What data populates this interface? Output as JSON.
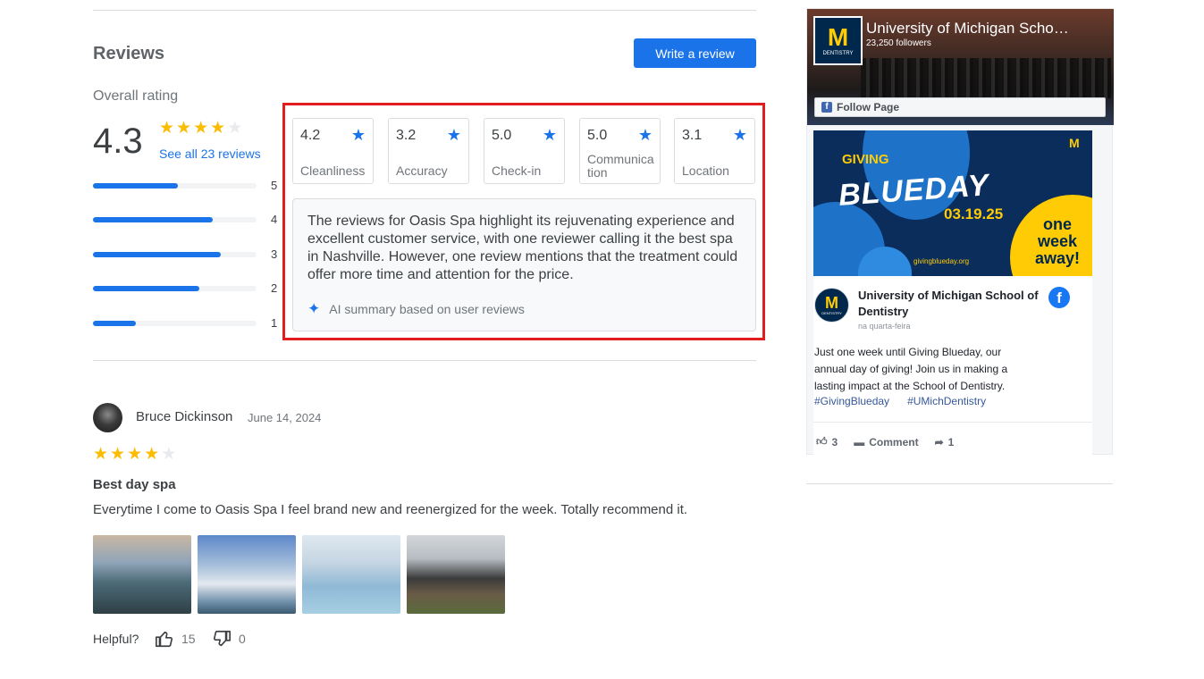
{
  "reviews": {
    "title": "Reviews",
    "write_label": "Write a review",
    "overall_label": "Overall rating",
    "rating": "4.3",
    "rating_stars": 4,
    "see_all": "See all 23 reviews",
    "distribution": [
      {
        "label": "5",
        "fraction": 0.52
      },
      {
        "label": "4",
        "fraction": 0.73
      },
      {
        "label": "3",
        "fraction": 0.78
      },
      {
        "label": "2",
        "fraction": 0.65
      },
      {
        "label": "1",
        "fraction": 0.26
      }
    ],
    "categories": [
      {
        "score": "4.2",
        "label": "Cleanliness"
      },
      {
        "score": "3.2",
        "label": "Accuracy"
      },
      {
        "score": "5.0",
        "label": "Check-in"
      },
      {
        "score": "5.0",
        "label": "Communication"
      },
      {
        "score": "3.1",
        "label": "Location"
      }
    ],
    "summary": "The reviews for Oasis Spa highlight its rejuvenating experience and excellent customer service, with one reviewer calling it the best spa in Nashville. However, one review mentions that the treatment could offer more time and attention for the price.",
    "ai_note": "AI summary based on user reviews"
  },
  "review_item": {
    "author": "Bruce Dickinson",
    "date": "June 14, 2024",
    "stars": 4,
    "title": "Best day spa",
    "body": "Everytime I come to Oasis Spa I feel brand new and reenergized for the week. Totally recommend it.",
    "helpful_label": "Helpful?",
    "likes": "15",
    "dislikes": "0"
  },
  "facebook": {
    "page_name": "University of Michigan Scho…",
    "followers": "23,250 followers",
    "follow_label": "Follow Page",
    "logo_letter": "M",
    "logo_text": "DENTISTRY",
    "banner": {
      "giving": "GIVING",
      "blueday": "BLUEDAY",
      "date": "03.19.25",
      "one_week": "one week away!",
      "url": "givingblueday.org"
    },
    "post_author": "University of Michigan School of Dentistry",
    "post_time": "na quarta-feira",
    "post_text": "Just one week until Giving Blueday, our annual day of giving! Join us in making a lasting impact at the School of Dentistry.",
    "tags": [
      "#GivingBlueday",
      "#UMichDentistry"
    ],
    "likes": "3",
    "comment_label": "Comment",
    "shares": "1"
  },
  "colors": {
    "accent": "#1a73e8",
    "star": "#fbbc04",
    "highlight_border": "#e01e1e",
    "michigan_blue": "#00274c",
    "michigan_maize": "#ffcb05"
  }
}
